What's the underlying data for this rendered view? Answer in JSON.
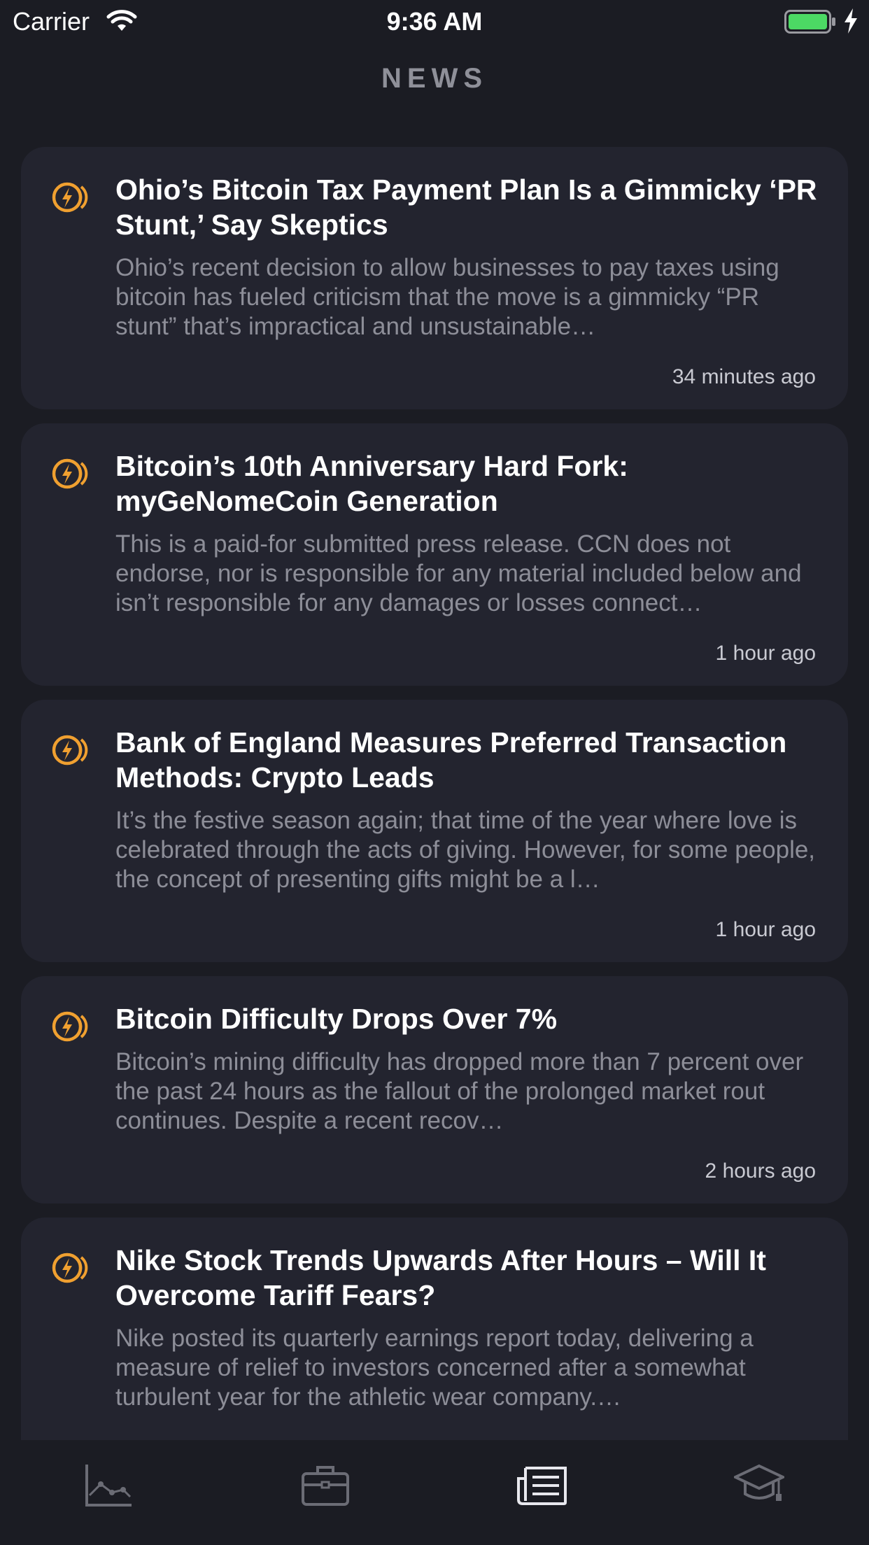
{
  "status_bar": {
    "carrier": "Carrier",
    "time": "9:36 AM",
    "battery_color": "#4cd964"
  },
  "header": {
    "title": "NEWS"
  },
  "colors": {
    "background": "#1b1c23",
    "card": "#23242f",
    "accent_logo": "#f0a030",
    "summary_text": "#8d8e98",
    "title_text": "#8f9099"
  },
  "news": [
    {
      "headline": "Ohio’s Bitcoin Tax Payment Plan Is a Gimmicky ‘PR Stunt,’ Say Skeptics",
      "summary": "Ohio’s recent decision to allow businesses to pay taxes using bitcoin has fueled criticism that the move is a gimmicky “PR stunt” that’s impractical and unsustainable…",
      "time": "34 minutes ago",
      "icon": "bitcoin-logo-icon"
    },
    {
      "headline": "Bitcoin’s 10th Anniversary Hard Fork: myGeNomeCoin Generation",
      "summary": "This is a paid-for submitted press release. CCN does not endorse, nor is responsible for any material included below and isn’t responsible for any damages or losses connect…",
      "time": "1 hour ago",
      "icon": "bitcoin-logo-icon"
    },
    {
      "headline": "Bank of England Measures Preferred Transaction Methods: Crypto Leads",
      "summary": "It’s the festive season again; that time of the year where love is celebrated through the acts of giving. However, for some people, the concept of presenting gifts might be a l…",
      "time": "1 hour ago",
      "icon": "bitcoin-logo-icon"
    },
    {
      "headline": "Bitcoin Difficulty Drops Over 7%",
      "summary": "Bitcoin’s mining difficulty has dropped more than 7 percent over the past 24 hours as the fallout of the prolonged market rout continues. Despite a recent recov…",
      "time": "2 hours ago",
      "icon": "bitcoin-logo-icon"
    },
    {
      "headline": "Nike Stock Trends Upwards After Hours – Will It Overcome Tariff Fears?",
      "summary": "Nike posted its quarterly earnings report today, delivering a measure of relief to investors concerned after a somewhat turbulent year for the athletic wear company.…",
      "time": "",
      "icon": "bitcoin-logo-icon"
    }
  ],
  "tab_bar": {
    "tabs": [
      {
        "icon": "chart-icon",
        "selected": false
      },
      {
        "icon": "briefcase-icon",
        "selected": false
      },
      {
        "icon": "news-icon",
        "selected": true
      },
      {
        "icon": "graduation-cap-icon",
        "selected": false
      }
    ]
  }
}
